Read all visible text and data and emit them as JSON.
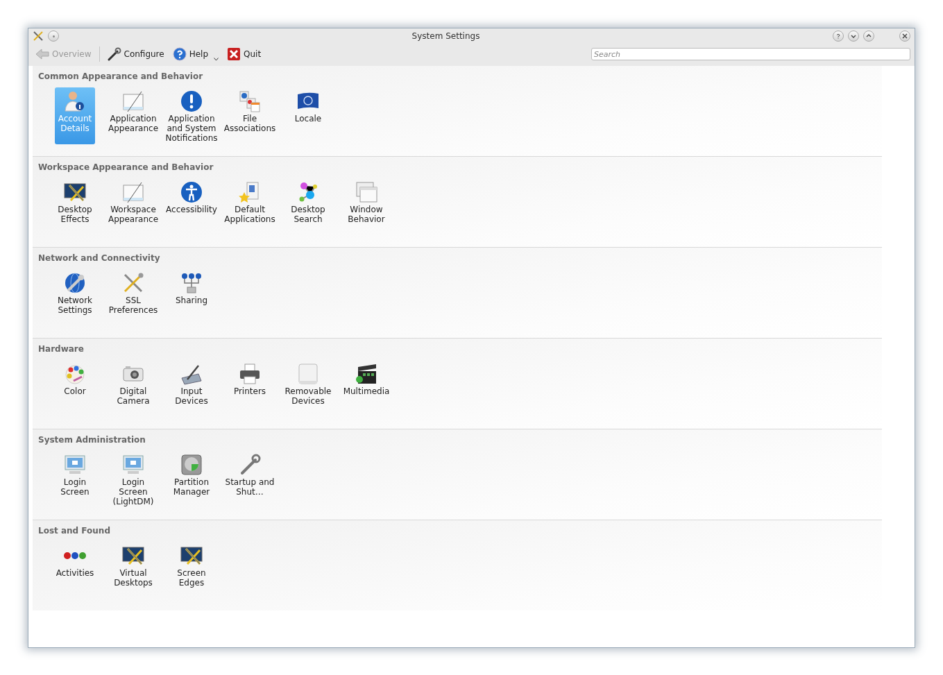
{
  "window": {
    "title": "System Settings"
  },
  "toolbar": [
    {
      "label": "Overview",
      "disabled": true,
      "kind": "back"
    },
    {
      "label": "Configure",
      "disabled": false,
      "kind": "configure"
    },
    {
      "label": "Help",
      "disabled": false,
      "kind": "help"
    },
    {
      "label": "Quit",
      "disabled": false,
      "kind": "quit"
    }
  ],
  "search": {
    "placeholder": "Search"
  },
  "sections": [
    {
      "title": "Common Appearance and Behavior",
      "items": [
        {
          "label": "Account Details",
          "selected": true
        },
        {
          "label": "Application Appearance",
          "selected": false
        },
        {
          "label": "Application and System Notifications",
          "selected": false
        },
        {
          "label": "File Associations",
          "selected": false
        },
        {
          "label": "Locale",
          "selected": false
        }
      ]
    },
    {
      "title": "Workspace Appearance and Behavior",
      "items": [
        {
          "label": "Desktop Effects",
          "selected": false
        },
        {
          "label": "Workspace Appearance",
          "selected": false
        },
        {
          "label": "Accessibility",
          "selected": false
        },
        {
          "label": "Default Applications",
          "selected": false
        },
        {
          "label": "Desktop Search",
          "selected": false
        },
        {
          "label": "Window Behavior",
          "selected": false
        }
      ]
    },
    {
      "title": "Network and Connectivity",
      "items": [
        {
          "label": "Network Settings",
          "selected": false
        },
        {
          "label": "SSL Preferences",
          "selected": false
        },
        {
          "label": "Sharing",
          "selected": false
        }
      ]
    },
    {
      "title": "Hardware",
      "items": [
        {
          "label": "Color",
          "selected": false
        },
        {
          "label": "Digital Camera",
          "selected": false
        },
        {
          "label": "Input Devices",
          "selected": false
        },
        {
          "label": "Printers",
          "selected": false
        },
        {
          "label": "Removable Devices",
          "selected": false
        },
        {
          "label": "Multimedia",
          "selected": false
        }
      ]
    },
    {
      "title": "System Administration",
      "items": [
        {
          "label": "Login Screen",
          "selected": false
        },
        {
          "label": "Login Screen (LightDM)",
          "selected": false
        },
        {
          "label": "Partition Manager",
          "selected": false
        },
        {
          "label": "Startup and Shut…",
          "selected": false
        }
      ]
    },
    {
      "title": "Lost and Found",
      "items": [
        {
          "label": "Activities",
          "selected": false
        },
        {
          "label": "Virtual Desktops",
          "selected": false
        },
        {
          "label": "Screen Edges",
          "selected": false
        }
      ]
    }
  ]
}
